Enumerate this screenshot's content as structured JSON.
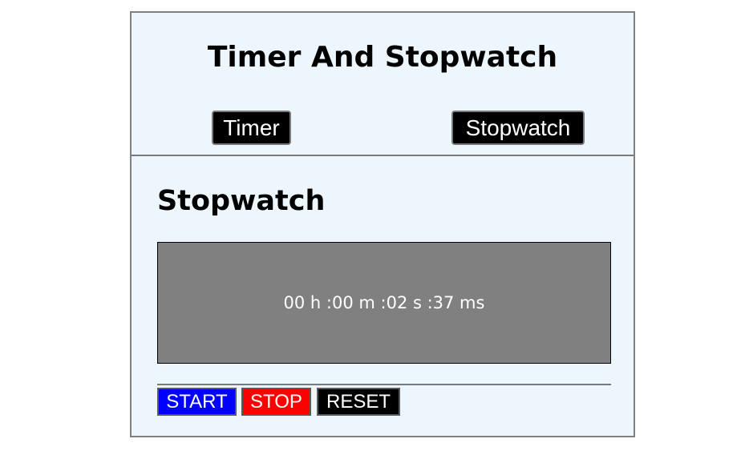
{
  "header": {
    "title": "Timer And Stopwatch",
    "timer_label": "Timer",
    "stopwatch_label": "Stopwatch"
  },
  "stopwatch": {
    "title": "Stopwatch",
    "display": "00 h :00 m :02 s :37 ms",
    "start_label": "START",
    "stop_label": "STOP",
    "reset_label": "RESET"
  },
  "colors": {
    "background": "#eef6fd",
    "display_bg": "#808080",
    "start": "#0000ff",
    "stop": "#ff0000",
    "reset": "#000000",
    "mode_button": "#000000"
  }
}
